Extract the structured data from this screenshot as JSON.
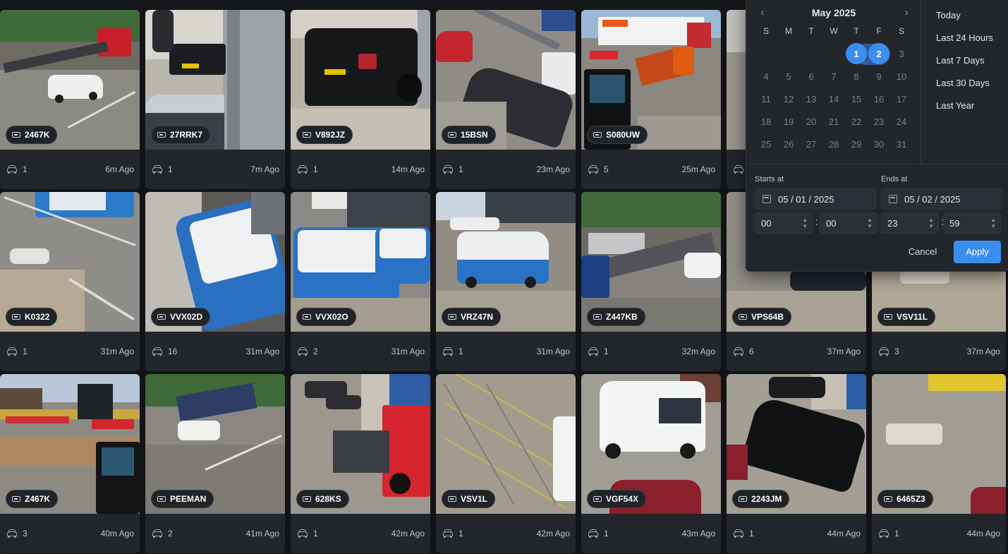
{
  "cards": [
    {
      "plate": "2467K",
      "count": "1",
      "time": "6m Ago"
    },
    {
      "plate": "27RRK7",
      "count": "1",
      "time": "7m Ago"
    },
    {
      "plate": "V892JZ",
      "count": "1",
      "time": "14m Ago"
    },
    {
      "plate": "15BSN",
      "count": "1",
      "time": "23m Ago"
    },
    {
      "plate": "S080UW",
      "count": "5",
      "time": "25m Ago"
    },
    {
      "plate": "",
      "count": "1",
      "time": ""
    },
    {
      "plate": "K0322",
      "count": "1",
      "time": "31m Ago"
    },
    {
      "plate": "VVX02D",
      "count": "16",
      "time": "31m Ago"
    },
    {
      "plate": "VVX02O",
      "count": "2",
      "time": "31m Ago"
    },
    {
      "plate": "VRZ47N",
      "count": "1",
      "time": "31m Ago"
    },
    {
      "plate": "Z447KB",
      "count": "1",
      "time": "32m Ago"
    },
    {
      "plate": "VPS64B",
      "count": "6",
      "time": "37m Ago"
    },
    {
      "plate": "VSV11L",
      "count": "3",
      "time": "37m Ago"
    },
    {
      "plate": "Z467K",
      "count": "3",
      "time": "40m Ago"
    },
    {
      "plate": "PEEMAN",
      "count": "2",
      "time": "41m Ago"
    },
    {
      "plate": "628KS",
      "count": "1",
      "time": "42m Ago"
    },
    {
      "plate": "VSV1L",
      "count": "1",
      "time": "42m Ago"
    },
    {
      "plate": "VGF54X",
      "count": "1",
      "time": "43m Ago"
    },
    {
      "plate": "2243JM",
      "count": "1",
      "time": "44m Ago"
    },
    {
      "plate": "6465Z3",
      "count": "1",
      "time": "44m Ago"
    }
  ],
  "picker": {
    "month_title": "May 2025",
    "weekdays": [
      "S",
      "M",
      "T",
      "W",
      "T",
      "F",
      "S"
    ],
    "weeks": [
      [
        "",
        "",
        "",
        "",
        "1",
        "2",
        "3"
      ],
      [
        "4",
        "5",
        "6",
        "7",
        "8",
        "9",
        "10"
      ],
      [
        "11",
        "12",
        "13",
        "14",
        "15",
        "16",
        "17"
      ],
      [
        "18",
        "19",
        "20",
        "21",
        "22",
        "23",
        "24"
      ],
      [
        "25",
        "26",
        "27",
        "28",
        "29",
        "30",
        "31"
      ]
    ],
    "selected_days": [
      "1",
      "2"
    ],
    "quick_ranges": [
      "Today",
      "Last 24 Hours",
      "Last 7 Days",
      "Last 30 Days",
      "Last Year"
    ],
    "starts_label": "Starts at",
    "ends_label": "Ends at",
    "start_date": "05 / 01 / 2025",
    "end_date": "05 / 02 / 2025",
    "start_hour": "00",
    "start_minute": "00",
    "end_hour": "23",
    "end_minute": "59",
    "cancel_label": "Cancel",
    "apply_label": "Apply",
    "accent_color": "#3b8ef0"
  }
}
